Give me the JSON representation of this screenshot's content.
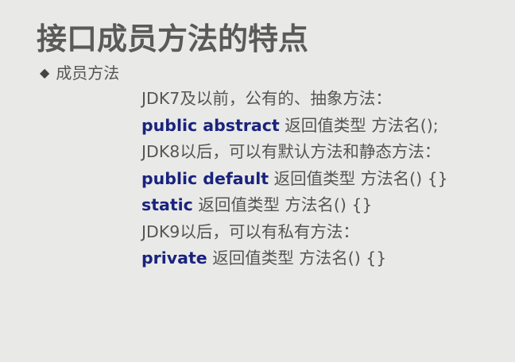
{
  "title": "接口成员方法的特点",
  "bullet": {
    "icon": "diamond-bullet-icon",
    "glyph": "◆",
    "label": "成员方法"
  },
  "lines": [
    {
      "text": "JDK7及以前，公有的、抽象方法："
    },
    {
      "keyword": "public abstract",
      "rest": " 返回值类型 方法名();"
    },
    {
      "text": "JDK8以后，可以有默认方法和静态方法："
    },
    {
      "keyword": "public default",
      "rest": " 返回值类型 方法名() {}"
    },
    {
      "keyword": "static",
      "rest": " 返回值类型 方法名() {}"
    },
    {
      "text": "JDK9以后，可以有私有方法："
    },
    {
      "keyword": "private",
      "rest": " 返回值类型 方法名() {}"
    }
  ],
  "colors": {
    "background": "#e9eae7",
    "title": "#5a5a5a",
    "text": "#555555",
    "keyword": "#1a237e"
  }
}
